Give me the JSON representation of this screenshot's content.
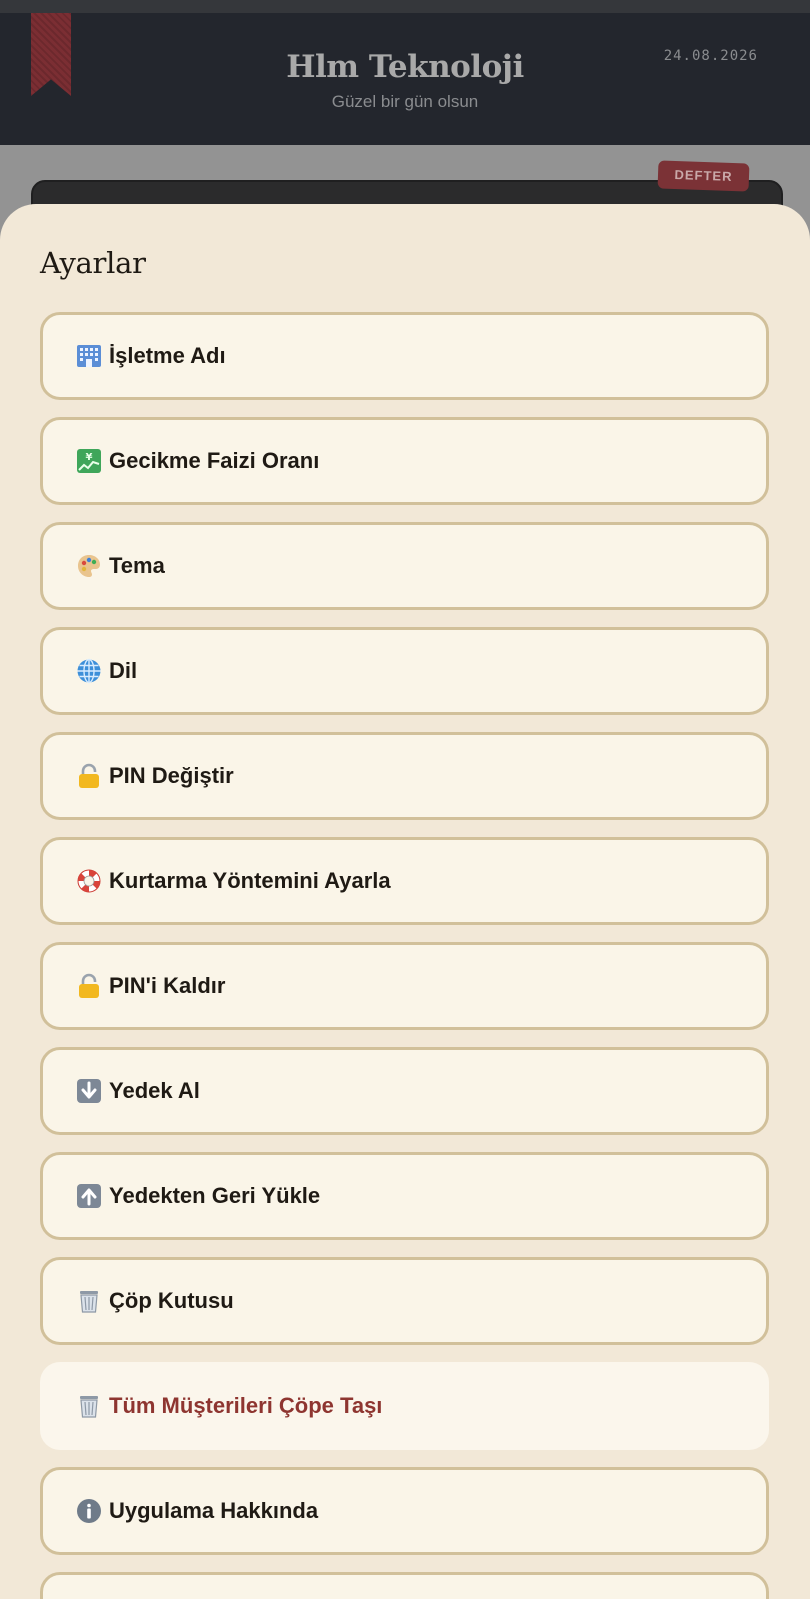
{
  "header": {
    "title": "Hlm Teknoloji",
    "subtitle": "Güzel bir gün olsun",
    "date": "24.08.2026"
  },
  "background_card": {
    "tag_label": "DEFTER"
  },
  "settings": {
    "title": "Ayarlar",
    "items": [
      {
        "label": "İşletme Adı",
        "icon": "building-icon"
      },
      {
        "label": "Gecikme Faizi Oranı",
        "icon": "chart-yen-icon"
      },
      {
        "label": "Tema",
        "icon": "palette-icon"
      },
      {
        "label": "Dil",
        "icon": "globe-icon"
      },
      {
        "label": "PIN Değiştir",
        "icon": "lock-icon"
      },
      {
        "label": "Kurtarma Yöntemini Ayarla",
        "icon": "lifebuoy-icon"
      },
      {
        "label": "PIN'i Kaldır",
        "icon": "lock-icon"
      },
      {
        "label": "Yedek Al",
        "icon": "arrow-down-icon"
      },
      {
        "label": "Yedekten Geri Yükle",
        "icon": "arrow-up-icon"
      },
      {
        "label": "Çöp Kutusu",
        "icon": "trash-icon"
      },
      {
        "label": "Tüm Müşterileri Çöpe Taşı",
        "icon": "trash-icon",
        "style": "danger"
      },
      {
        "label": "Uygulama Hakkında",
        "icon": "info-icon"
      }
    ]
  },
  "colors": {
    "accent_danger": "#8e3530",
    "sheet_background": "#f2e8d7",
    "item_border": "#d1c09a",
    "header_background": "#23262d"
  }
}
